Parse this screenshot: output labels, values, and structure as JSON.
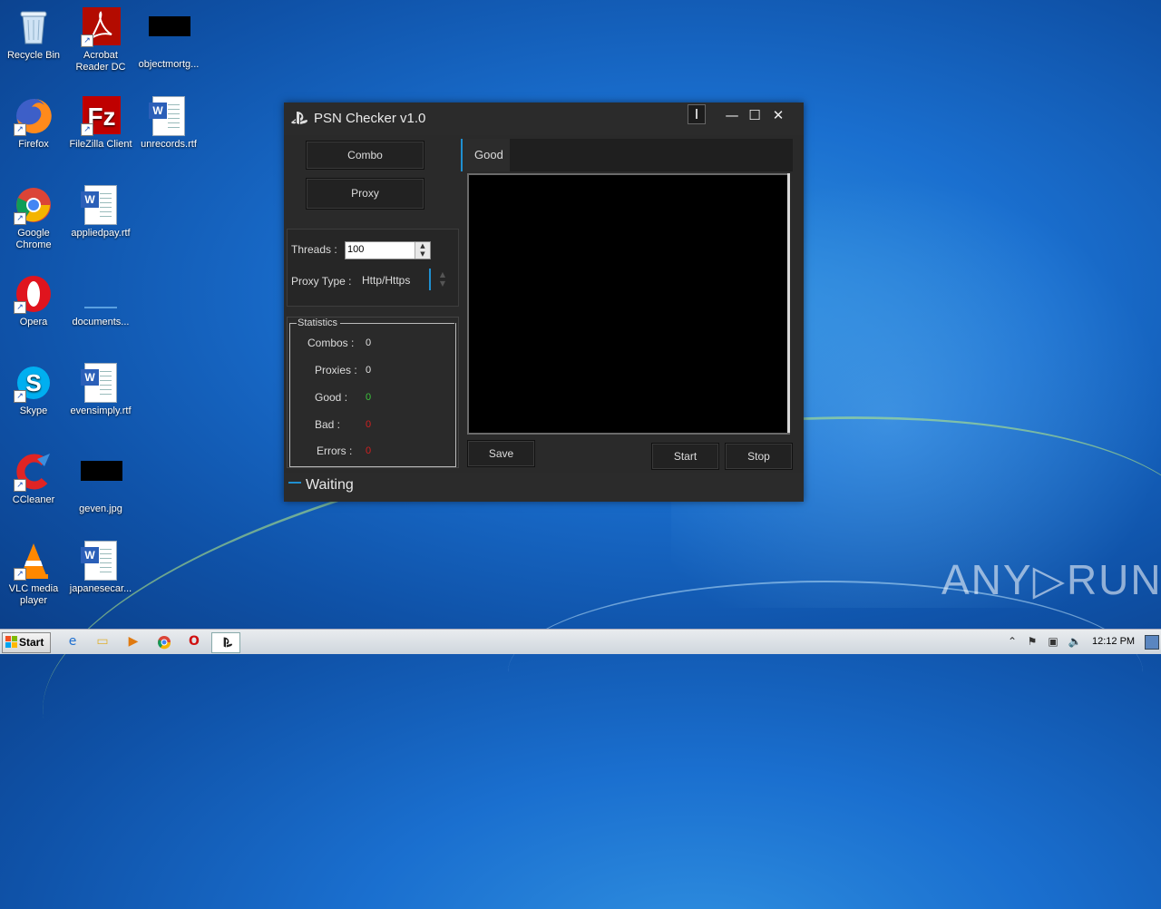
{
  "desktop": {
    "icons": [
      {
        "label": "Recycle Bin"
      },
      {
        "label": "Acrobat Reader DC"
      },
      {
        "label": "objectmortg..."
      },
      {
        "label": "Firefox"
      },
      {
        "label": "FileZilla Client"
      },
      {
        "label": "unrecords.rtf"
      },
      {
        "label": "Google Chrome"
      },
      {
        "label": "appliedpay.rtf"
      },
      {
        "label": "Opera"
      },
      {
        "label": "documents..."
      },
      {
        "label": "Skype"
      },
      {
        "label": "evensimply.rtf"
      },
      {
        "label": "CCleaner"
      },
      {
        "label": "geven.jpg"
      },
      {
        "label": "VLC media player"
      },
      {
        "label": "japanesecar..."
      }
    ]
  },
  "window": {
    "title": "PSN Checker v1.0",
    "controls": {
      "minimize": "—",
      "maximize": "☐",
      "close": "✕"
    },
    "buttons": {
      "combo": "Combo",
      "proxy": "Proxy",
      "save": "Save",
      "start": "Start",
      "stop": "Stop"
    },
    "settings": {
      "threads_label": "Threads :",
      "threads_value": "100",
      "proxy_type_label": "Proxy Type :",
      "proxy_type_value": "Http/Https"
    },
    "statistics": {
      "title": "Statistics",
      "rows": [
        {
          "label": "Combos :",
          "value": "0",
          "color": "#e0e0e0"
        },
        {
          "label": "Proxies :",
          "value": "0",
          "color": "#e0e0e0"
        },
        {
          "label": "Good :",
          "value": "0",
          "color": "#3cc43c"
        },
        {
          "label": "Bad :",
          "value": "0",
          "color": "#d02020"
        },
        {
          "label": "Errors :",
          "value": "0",
          "color": "#d02020"
        }
      ]
    },
    "tabs": [
      {
        "label": "Good"
      }
    ],
    "status": "Waiting",
    "accent": "#1f8fd0"
  },
  "taskbar": {
    "start_label": "Start",
    "clock": "12:12 PM"
  },
  "watermark": "ANY▷RUN"
}
